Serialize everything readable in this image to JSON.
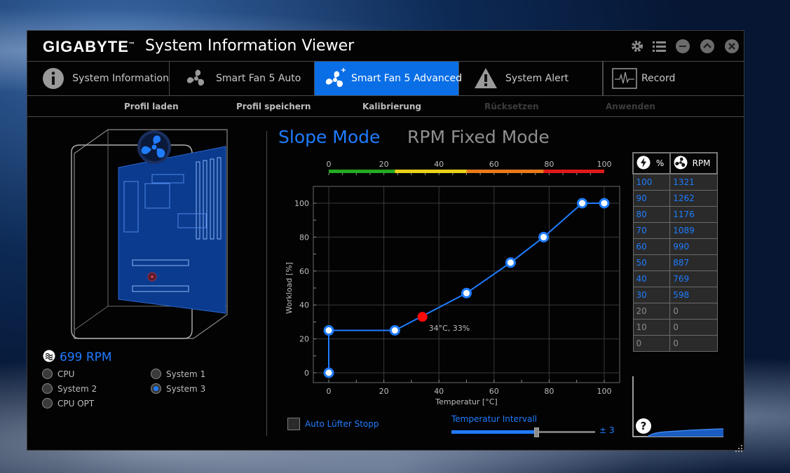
{
  "app": {
    "brand": "GIGABYTE",
    "brand_tm": "™",
    "title": "System Information Viewer"
  },
  "title_controls": [
    "settings-icon",
    "list-icon",
    "minimize-icon",
    "collapse-icon",
    "close-icon"
  ],
  "tabs": [
    {
      "label": "System Information",
      "icon": "info-icon",
      "active": false
    },
    {
      "label": "Smart Fan 5 Auto",
      "icon": "fan-icon",
      "active": false
    },
    {
      "label": "Smart Fan 5 Advanced",
      "icon": "fan-plus-icon",
      "active": true
    },
    {
      "label": "System Alert",
      "icon": "warning-icon",
      "active": false
    },
    {
      "label": "Record",
      "icon": "record-icon",
      "active": false
    }
  ],
  "subtoolbar": [
    {
      "label": "Profil laden",
      "enabled": true
    },
    {
      "label": "Profil speichern",
      "enabled": true
    },
    {
      "label": "Kalibrierung",
      "enabled": true
    },
    {
      "label": "Rücksetzen",
      "enabled": false
    },
    {
      "label": "Anwenden",
      "enabled": false
    }
  ],
  "fan_status": {
    "rpm": "699 RPM"
  },
  "fan_sources": [
    {
      "label": "CPU",
      "selected": false
    },
    {
      "label": "System 2",
      "selected": false
    },
    {
      "label": "CPU OPT",
      "selected": false
    },
    {
      "label": "System 1",
      "selected": false
    },
    {
      "label": "System 3",
      "selected": true
    }
  ],
  "modes": {
    "slope": "Slope Mode",
    "rpm_fixed": "RPM Fixed Mode",
    "active": "slope"
  },
  "chart_data": {
    "type": "line",
    "xlabel": "Temperatur [°C]",
    "ylabel": "Workload [%]",
    "xlim": [
      0,
      100
    ],
    "ylim": [
      0,
      100
    ],
    "xticks": [
      0,
      20,
      40,
      60,
      80,
      100
    ],
    "yticks": [
      0,
      20,
      40,
      60,
      80,
      100
    ],
    "grid": true,
    "temperature_bar_ticks": [
      0,
      20,
      40,
      60,
      80,
      100
    ],
    "temperature_bar_colors": [
      "#22aa22",
      "#e8d21a",
      "#e87a1a",
      "#e01a1a"
    ],
    "temperature_bar_stops": [
      0,
      24,
      50,
      78,
      100
    ],
    "series": [
      {
        "points": [
          [
            0,
            0
          ],
          [
            0,
            25
          ],
          [
            24,
            25
          ],
          [
            50,
            47
          ],
          [
            66,
            65
          ],
          [
            78,
            80
          ],
          [
            92,
            100
          ],
          [
            100,
            100
          ]
        ]
      }
    ],
    "current_point": {
      "x": 34,
      "y": 33,
      "label": "34°C, 33%"
    }
  },
  "auto_stop": {
    "label": "Auto Lüfter Stopp",
    "checked": false
  },
  "temp_interval": {
    "label": "Temperatur Intervall",
    "value_label": "± 3",
    "position": 0.59
  },
  "rpm_table": {
    "headers": [
      "%",
      "RPM"
    ],
    "rows": [
      [
        "100",
        "1321"
      ],
      [
        "90",
        "1262"
      ],
      [
        "80",
        "1176"
      ],
      [
        "70",
        "1089"
      ],
      [
        "60",
        "990"
      ],
      [
        "50",
        "887"
      ],
      [
        "40",
        "769"
      ],
      [
        "30",
        "598"
      ],
      [
        "20",
        "0"
      ],
      [
        "10",
        "0"
      ],
      [
        "0",
        "0"
      ]
    ]
  },
  "help": {
    "label": "?"
  },
  "colors": {
    "accent": "#1f7cff",
    "tab_active": "#0a6ee6",
    "point_current": "#ff0a0a"
  }
}
